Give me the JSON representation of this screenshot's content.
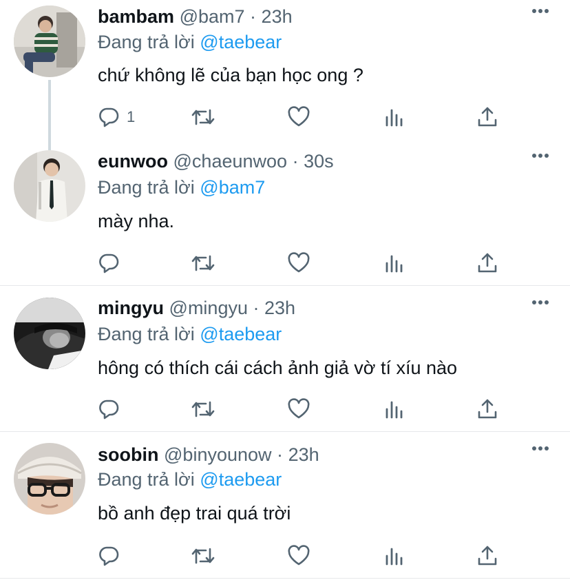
{
  "tweets": [
    {
      "display_name": "bambam",
      "handle": "@bam7",
      "separator": "·",
      "time": "23h",
      "reply_prefix": "Đang trả lời",
      "reply_to": "@taebear",
      "text": "chứ không lẽ của bạn học ong ?",
      "reply_count": "1",
      "avatar_icon": "avatar-photo-icon"
    },
    {
      "display_name": "eunwoo",
      "handle": "@chaeunwoo",
      "separator": "·",
      "time": "30s",
      "reply_prefix": "Đang trả lời",
      "reply_to": "@bam7",
      "text": "mày nha.",
      "reply_count": "",
      "avatar_icon": "avatar-photo-icon"
    },
    {
      "display_name": "mingyu",
      "handle": "@mingyu",
      "separator": "·",
      "time": "23h",
      "reply_prefix": "Đang trả lời",
      "reply_to": "@taebear",
      "text": "hông có thích cái cách ảnh giả vờ tí xíu nào",
      "reply_count": "",
      "avatar_icon": "avatar-photo-icon"
    },
    {
      "display_name": "soobin",
      "handle": "@binyounow",
      "separator": "·",
      "time": "23h",
      "reply_prefix": "Đang trả lời",
      "reply_to": "@taebear",
      "text": "bồ anh đẹp trai quá trời",
      "reply_count": "",
      "avatar_icon": "avatar-photo-icon"
    }
  ],
  "colors": {
    "text": "#0f1419",
    "secondary": "#536471",
    "mention": "#1d9bf0",
    "divider": "#e6e8ea",
    "thread_line": "#cfd9de"
  },
  "icons": {
    "reply": "reply-icon",
    "retweet": "retweet-icon",
    "like": "heart-icon",
    "stats": "analytics-icon",
    "share": "share-icon",
    "more": "more-icon"
  }
}
